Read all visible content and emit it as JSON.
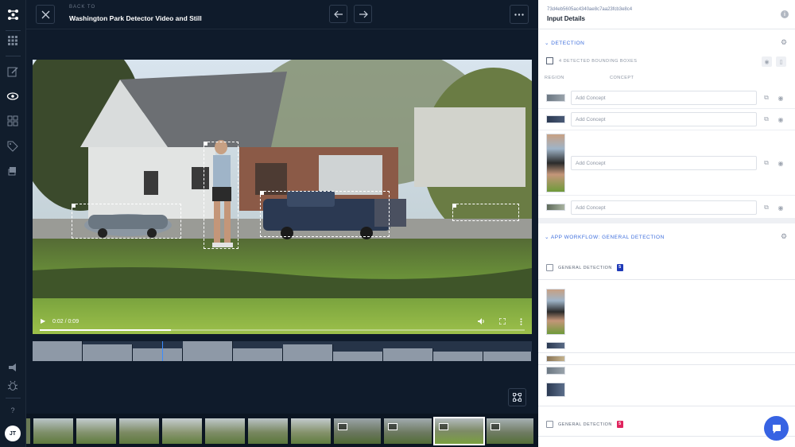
{
  "topbar": {
    "back_to": "BACK TO",
    "title": "Washington Park Detector Video and Still",
    "prev_icon": "arrow-left-icon",
    "next_icon": "arrow-right-icon",
    "more_icon": "more-icon",
    "close_icon": "close-icon"
  },
  "rail": {
    "icons": [
      "logo-icon",
      "grid-icon",
      "edit-icon",
      "eye-icon",
      "apps-icon",
      "tag-icon",
      "stack-icon",
      "megaphone-icon",
      "bug-icon",
      "help-icon"
    ],
    "help": "?",
    "avatar": "JT"
  },
  "video": {
    "time": "0:02 / 0:09",
    "progress": 0.27,
    "play_icon": "play-icon"
  },
  "panel": {
    "input_id": "73d4eb5605ac4340ae8c7aa23fcb3e8c4",
    "header": "Input Details",
    "detection": {
      "section_label": "DETECTION",
      "count_label": "4 DETECTED BOUNDING BOXES",
      "col_region": "REGION",
      "col_concept": "CONCEPT",
      "rows": [
        {
          "placeholder": "Add Concept"
        },
        {
          "placeholder": "Add Concept"
        },
        {
          "placeholder": "Add Concept"
        },
        {
          "placeholder": "Add Concept"
        }
      ]
    },
    "workflow": {
      "section_label": "APP WORKFLOW: GENERAL DETECTION",
      "models": [
        {
          "name": "GENERAL DETECTION",
          "badge": "5",
          "badge_color": "#1f3ab8"
        },
        {
          "name": "GENERAL DETECTION",
          "badge": "5",
          "badge_color": "#e0245e"
        }
      ]
    }
  },
  "colors": {
    "accent": "#3d6edc",
    "chat": "#3763e3"
  }
}
